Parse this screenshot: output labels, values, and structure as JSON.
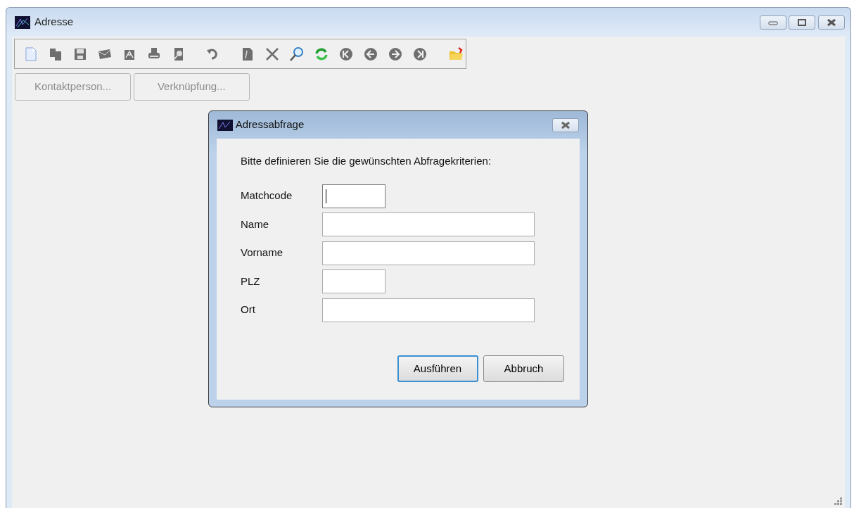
{
  "window": {
    "title": "Adresse"
  },
  "buttons": [
    {
      "label": "Kontaktperson...",
      "disabled": true
    },
    {
      "label": "Verknüpfung...",
      "disabled": true
    }
  ],
  "dialog": {
    "title": "Adressabfrage",
    "prompt": "Bitte definieren Sie die gewünschten Abfragekriterien:",
    "fields": [
      {
        "label": "Matchcode",
        "kind": "short",
        "focused": true
      },
      {
        "label": "Name",
        "kind": "wide",
        "focused": false
      },
      {
        "label": "Vorname",
        "kind": "wide",
        "focused": false
      },
      {
        "label": "PLZ",
        "kind": "short",
        "focused": false
      },
      {
        "label": "Ort",
        "kind": "wide",
        "focused": false
      }
    ],
    "buttons": [
      {
        "label": "Ausführen",
        "default": true
      },
      {
        "label": "Abbruch",
        "default": false
      }
    ]
  }
}
